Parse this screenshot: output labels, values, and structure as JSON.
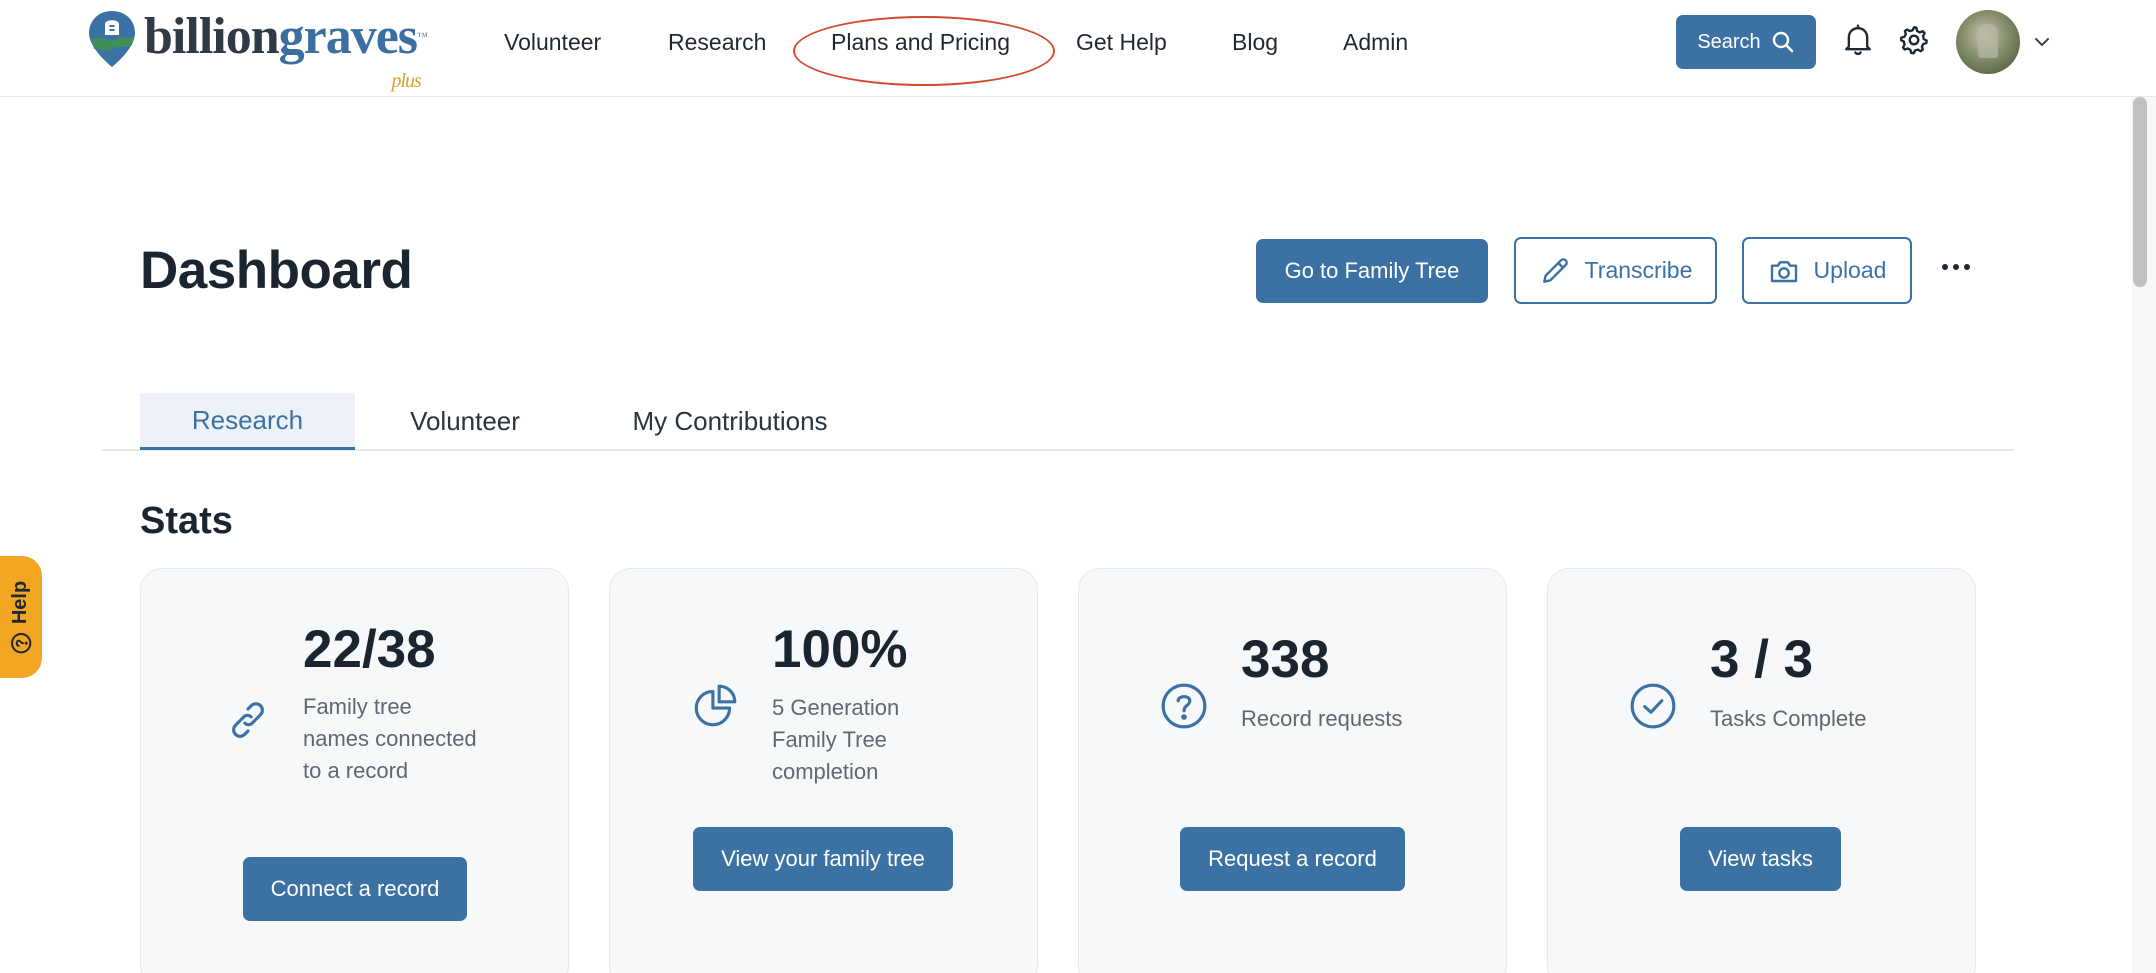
{
  "brand": {
    "word_dark": "billion",
    "word_blue": "graves",
    "trademark": "™",
    "plus": "plus"
  },
  "nav": {
    "items": [
      {
        "label": "Volunteer"
      },
      {
        "label": "Research"
      },
      {
        "label": "Plans and Pricing"
      },
      {
        "label": "Get Help"
      },
      {
        "label": "Blog"
      },
      {
        "label": "Admin"
      }
    ],
    "search_label": "Search",
    "highlight_color": "#d2492e"
  },
  "help_tab": {
    "label": "Help",
    "color": "#f3a623"
  },
  "page": {
    "title": "Dashboard",
    "actions": {
      "family_tree": "Go to Family Tree",
      "transcribe": "Transcribe",
      "upload": "Upload"
    }
  },
  "tabs": [
    {
      "label": "Research",
      "active": true
    },
    {
      "label": "Volunteer",
      "active": false
    },
    {
      "label": "My Contributions",
      "active": false
    }
  ],
  "stats": {
    "title": "Stats",
    "cards": [
      {
        "value": "22/38",
        "label": "Family tree names connected to a record",
        "button": "Connect a record",
        "icon": "link-icon"
      },
      {
        "value": "100%",
        "label": "5 Generation Family Tree completion",
        "button": "View your family tree",
        "icon": "pie-chart-icon"
      },
      {
        "value": "338",
        "label": "Record requests",
        "button": "Request a record",
        "icon": "question-circle-icon"
      },
      {
        "value": "3 / 3",
        "label": "Tasks Complete",
        "button": "View tasks",
        "icon": "check-circle-icon"
      }
    ]
  },
  "colors": {
    "accent": "#3c72a3",
    "text": "#1b2530",
    "muted": "#5e6873",
    "card_bg": "#f6f8fa"
  }
}
